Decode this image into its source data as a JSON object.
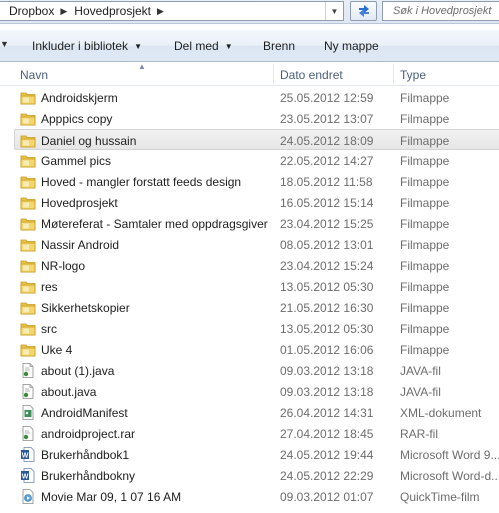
{
  "address": {
    "crumbs": [
      "Dropbox",
      "Hovedprosjekt"
    ],
    "search_placeholder": "Søk i Hovedprosjekt"
  },
  "toolbar": {
    "include_label": "Inkluder i bibliotek",
    "share_label": "Del med",
    "burn_label": "Brenn",
    "new_folder_label": "Ny mappe"
  },
  "columns": {
    "name": "Navn",
    "date": "Dato endret",
    "type": "Type"
  },
  "files": [
    {
      "name": "Androidskjerm",
      "date": "25.05.2012 12:59",
      "type": "Filmappe",
      "icon": "folder-icon"
    },
    {
      "name": "Apppics copy",
      "date": "23.05.2012 13:07",
      "type": "Filmappe",
      "icon": "folder-icon"
    },
    {
      "name": "Daniel og hussain",
      "date": "24.05.2012 18:09",
      "type": "Filmappe",
      "icon": "folder-icon",
      "selected": true
    },
    {
      "name": "Gammel pics",
      "date": "22.05.2012 14:27",
      "type": "Filmappe",
      "icon": "folder-icon"
    },
    {
      "name": "Hoved - mangler forstatt feeds design",
      "date": "18.05.2012 11:58",
      "type": "Filmappe",
      "icon": "folder-icon"
    },
    {
      "name": "Hovedprosjekt",
      "date": "16.05.2012 15:14",
      "type": "Filmappe",
      "icon": "folder-icon"
    },
    {
      "name": "Møtereferat - Samtaler med oppdragsgiver",
      "date": "23.04.2012 15:25",
      "type": "Filmappe",
      "icon": "folder-icon"
    },
    {
      "name": "Nassir Android",
      "date": "08.05.2012 13:01",
      "type": "Filmappe",
      "icon": "folder-icon"
    },
    {
      "name": "NR-logo",
      "date": "23.04.2012 15:24",
      "type": "Filmappe",
      "icon": "folder-icon"
    },
    {
      "name": "res",
      "date": "13.05.2012 05:30",
      "type": "Filmappe",
      "icon": "folder-icon"
    },
    {
      "name": "Sikkerhetskopier",
      "date": "21.05.2012 16:30",
      "type": "Filmappe",
      "icon": "folder-icon"
    },
    {
      "name": "src",
      "date": "13.05.2012 05:30",
      "type": "Filmappe",
      "icon": "folder-icon"
    },
    {
      "name": "Uke 4",
      "date": "01.05.2012 16:06",
      "type": "Filmappe",
      "icon": "folder-icon"
    },
    {
      "name": "about (1).java",
      "date": "09.03.2012 13:18",
      "type": "JAVA-fil",
      "icon": "java-file-icon"
    },
    {
      "name": "about.java",
      "date": "09.03.2012 13:18",
      "type": "JAVA-fil",
      "icon": "java-file-icon"
    },
    {
      "name": "AndroidManifest",
      "date": "26.04.2012 14:31",
      "type": "XML-dokument",
      "icon": "xml-file-icon"
    },
    {
      "name": "androidproject.rar",
      "date": "27.04.2012 18:45",
      "type": "RAR-fil",
      "icon": "rar-file-icon"
    },
    {
      "name": "Brukerhåndbok1",
      "date": "24.05.2012 19:44",
      "type": "Microsoft Word 9...",
      "icon": "word-doc-icon"
    },
    {
      "name": "Brukerhåndbokny",
      "date": "24.05.2012 22:29",
      "type": "Microsoft Word-d...",
      "icon": "word-doc-icon"
    },
    {
      "name": "Movie Mar 09, 1 07 16 AM",
      "date": "09.03.2012 01:07",
      "type": "QuickTime-film",
      "icon": "quicktime-file-icon"
    }
  ]
}
